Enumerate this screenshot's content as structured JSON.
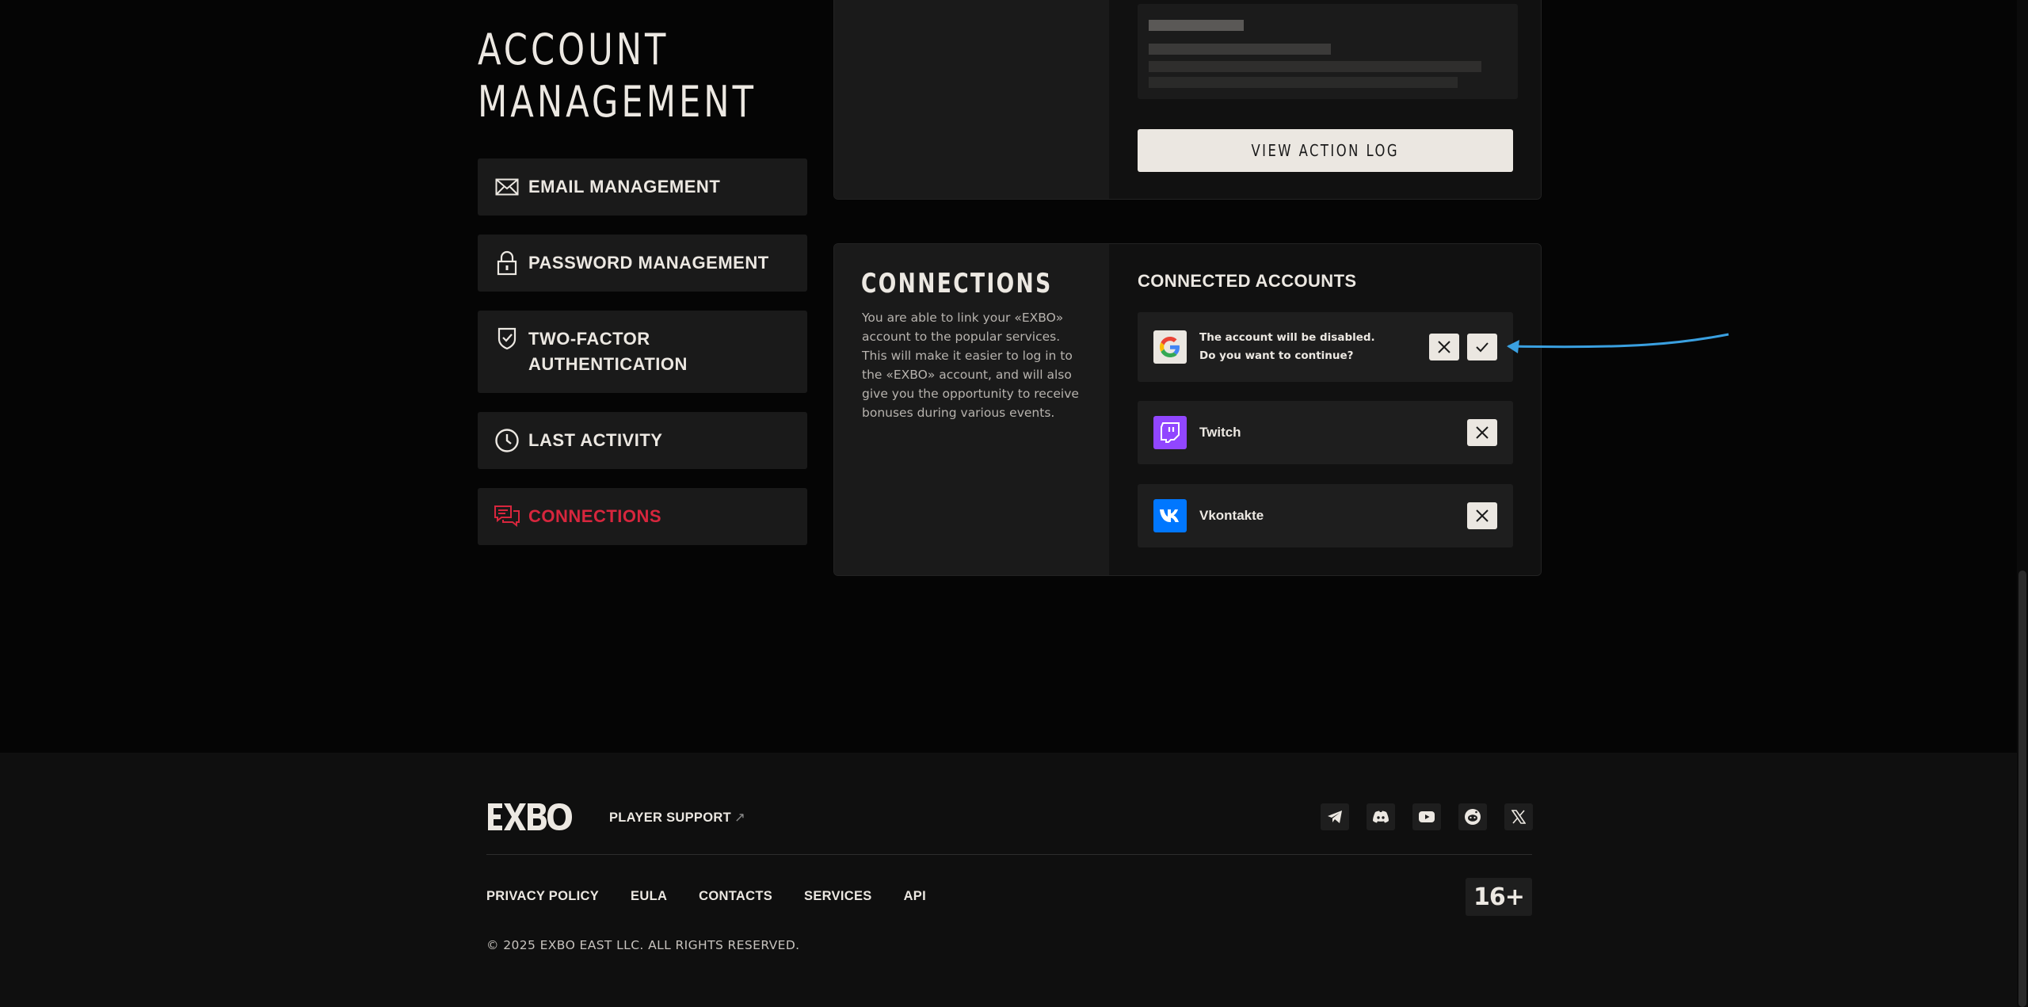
{
  "page": {
    "title_line1": "ACCOUNT",
    "title_line2": "MANAGEMENT"
  },
  "sidebar": {
    "items": [
      {
        "label": "EMAIL MANAGEMENT",
        "icon": "envelope-icon"
      },
      {
        "label": "PASSWORD MANAGEMENT",
        "icon": "lock-icon"
      },
      {
        "label": "TWO-FACTOR",
        "label_line2": "AUTHENTICATION",
        "icon": "shield-check-icon"
      },
      {
        "label": "LAST ACTIVITY",
        "icon": "clock-icon"
      },
      {
        "label": "CONNECTIONS",
        "icon": "chat-bubbles-icon",
        "active": true
      }
    ]
  },
  "action_log": {
    "button_label": "VIEW ACTION LOG"
  },
  "connections": {
    "title": "CONNECTIONS",
    "description": "You are able to link your «EXBO» account to the popular services. This will make it easier to log in to the «EXBO» account, and will also give you the opportunity to receive bonuses during various events.",
    "accounts_title": "CONNECTED ACCOUNTS",
    "accounts": [
      {
        "service": "Google",
        "icon": "google-icon",
        "confirm_line1": "The account will be disabled.",
        "confirm_line2": "Do you want to continue?"
      },
      {
        "service": "Twitch",
        "icon": "twitch-icon",
        "color": "#9146ff"
      },
      {
        "service": "Vkontakte",
        "icon": "vk-icon",
        "color": "#0077ff"
      }
    ]
  },
  "footer": {
    "logo": "EXBO",
    "support_label": "PLAYER SUPPORT",
    "support_arrow": "↗",
    "socials": [
      "telegram-icon",
      "discord-icon",
      "youtube-icon",
      "reddit-icon",
      "x-icon"
    ],
    "links": [
      "PRIVACY POLICY",
      "EULA",
      "CONTACTS",
      "SERVICES",
      "API"
    ],
    "age_rating": "16+",
    "copyright": "© 2025 EXBO EAST LLC. ALL RIGHTS RESERVED."
  },
  "colors": {
    "accent_red": "#d7263d",
    "annotation_arrow": "#3aa0e0"
  }
}
